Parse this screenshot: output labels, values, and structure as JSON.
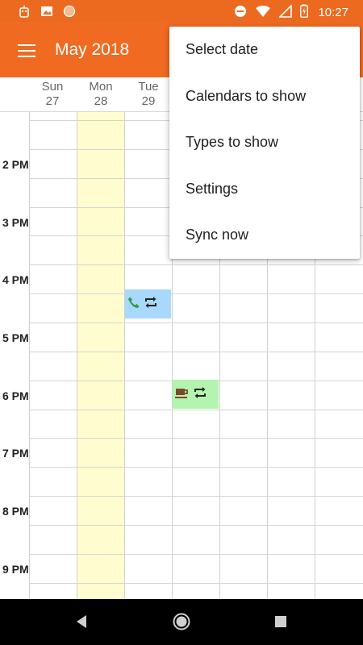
{
  "status_bar": {
    "time": "10:27",
    "left_icons": [
      "notification-app-icon",
      "image-icon",
      "circle-icon"
    ],
    "right_icons": [
      "do-not-disturb-icon",
      "wifi-icon",
      "signal-icon",
      "battery-charging-icon"
    ]
  },
  "app_bar": {
    "title": "May 2018",
    "menu_icon": "hamburger-menu-icon"
  },
  "days": [
    {
      "name": "Sun",
      "date": "27"
    },
    {
      "name": "Mon",
      "date": "28"
    },
    {
      "name": "Tue",
      "date": "29"
    }
  ],
  "time_labels": [
    "2 PM",
    "3 PM",
    "4 PM",
    "5 PM",
    "6 PM",
    "7 PM",
    "8 PM",
    "9 PM"
  ],
  "events": [
    {
      "day": "Tue 29",
      "time": "4:30 PM",
      "icons": [
        "phone-icon",
        "repeat-icon"
      ],
      "color": "#a8d8fb"
    },
    {
      "day": "Wed 30",
      "time": "6:00 PM",
      "icons": [
        "coffee-icon",
        "repeat-icon"
      ],
      "color": "#b3f5b0"
    }
  ],
  "colors": {
    "accent": "#f06a21",
    "today_highlight": "#fffdd0"
  },
  "overflow_menu": {
    "items": [
      "Select date",
      "Calendars to show",
      "Types to show",
      "Settings",
      "Sync now"
    ]
  },
  "nav_bar": {
    "buttons": [
      "back-icon",
      "home-icon",
      "recents-icon"
    ]
  }
}
